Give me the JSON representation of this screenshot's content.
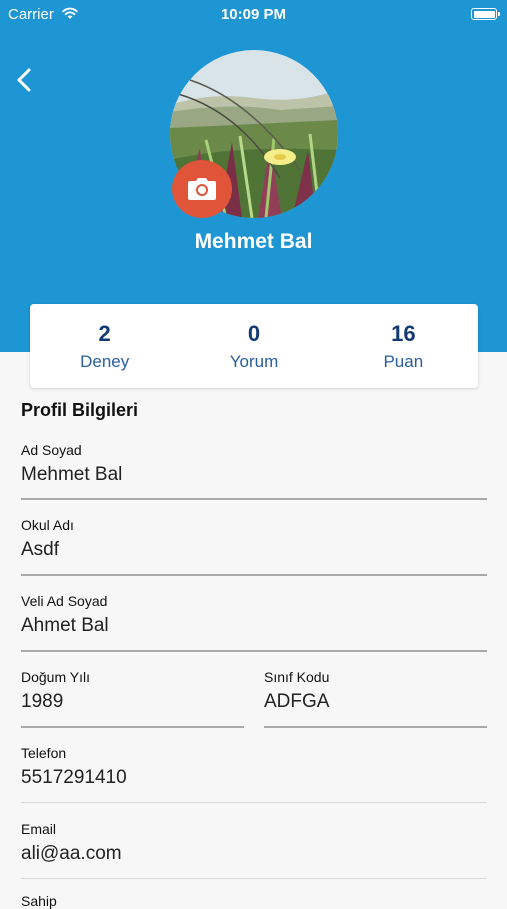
{
  "status_bar": {
    "carrier": "Carrier",
    "time": "10:09 PM"
  },
  "profile": {
    "name": "Mehmet Bal"
  },
  "stats": [
    {
      "value": "2",
      "label": "Deney"
    },
    {
      "value": "0",
      "label": "Yorum"
    },
    {
      "value": "16",
      "label": "Puan"
    }
  ],
  "section": {
    "title": "Profil Bilgileri"
  },
  "fields": {
    "full_name": {
      "label": "Ad Soyad",
      "value": "Mehmet Bal"
    },
    "school": {
      "label": "Okul Adı",
      "value": "Asdf"
    },
    "parent_name": {
      "label": "Veli Ad Soyad",
      "value": "Ahmet Bal"
    },
    "birth_year": {
      "label": "Doğum Yılı",
      "value": "1989"
    },
    "class_code": {
      "label": "Sınıf Kodu",
      "value": "ADFGA"
    },
    "phone": {
      "label": "Telefon",
      "value": "5517291410"
    },
    "email": {
      "label": "Email",
      "value": "ali@aa.com"
    },
    "partial": {
      "label": "Sahip"
    }
  },
  "colors": {
    "header": "#1e96d4",
    "camera": "#e0553a",
    "stat_value": "#133a73"
  },
  "icons": [
    "wifi-icon",
    "battery-icon",
    "back-chevron-icon",
    "camera-icon"
  ]
}
